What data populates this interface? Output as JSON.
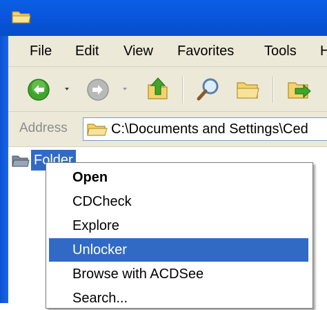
{
  "menu": {
    "items": [
      "File",
      "Edit",
      "View",
      "Favorites",
      "Tools",
      "H"
    ]
  },
  "toolbar": {
    "buttons": [
      "back-icon",
      "forward-icon",
      "up-folder-icon",
      "search-icon",
      "folders-icon",
      "move-to-icon"
    ]
  },
  "address": {
    "label": "Address",
    "path": "C:\\Documents and Settings\\Ced"
  },
  "tree": {
    "selected_label": "Folder"
  },
  "context_menu": {
    "items": [
      "Open",
      "CDCheck",
      "Explore",
      "Unlocker",
      "Browse with ACDSee",
      "Search..."
    ],
    "bold_item": "Open",
    "highlighted_item": "Unlocker"
  },
  "colors": {
    "title_bar": "#0a56de",
    "highlight": "#316ac5",
    "window_bg": "#ece9d8"
  }
}
